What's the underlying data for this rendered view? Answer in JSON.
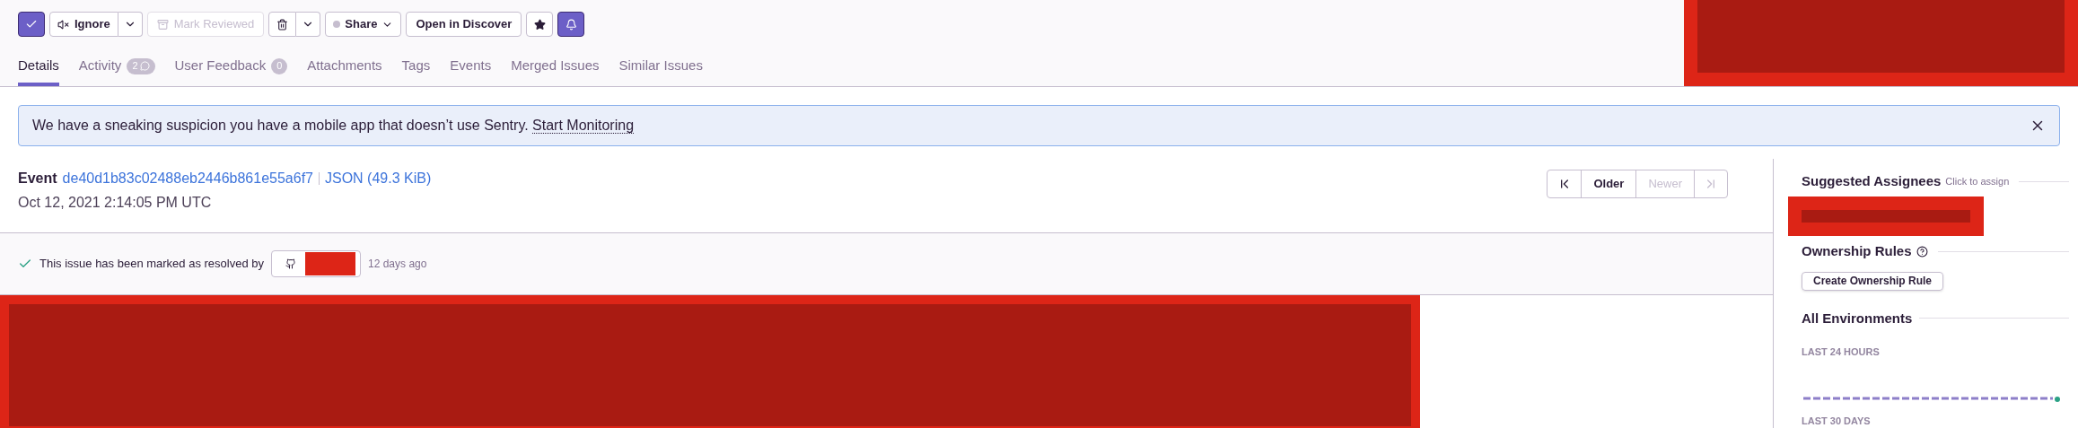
{
  "toolbar": [
    {
      "kind": "resolve",
      "selected": true
    },
    {
      "kind": "split",
      "label": "Ignore"
    },
    {
      "kind": "text",
      "label": "Mark Reviewed",
      "disabled": true
    },
    {
      "kind": "delete"
    },
    {
      "kind": "share",
      "label": "Share"
    },
    {
      "kind": "text",
      "label": "Open in Discover",
      "disabled": false
    },
    {
      "kind": "bookmark",
      "selected": false
    },
    {
      "kind": "subscribe",
      "selected": true
    }
  ],
  "tabs": [
    {
      "label": "Details",
      "selected": true
    },
    {
      "label": "Activity",
      "selected": false,
      "badge": "2",
      "kind": "comments"
    },
    {
      "label": "User Feedback",
      "selected": false,
      "badge": "0",
      "kind": "count"
    },
    {
      "label": "Attachments",
      "selected": false
    },
    {
      "label": "Tags",
      "selected": false
    },
    {
      "label": "Events",
      "selected": false
    },
    {
      "label": "Merged Issues",
      "selected": false
    },
    {
      "label": "Similar Issues",
      "selected": false
    }
  ],
  "banner": {
    "text": "We have a sneaking suspicion you have a mobile app that doesn’t use Sentry.",
    "link": "Start Monitoring"
  },
  "event": {
    "label": "Event",
    "id": "de40d1b83c02488eb2446b861e55a6f7",
    "json": "JSON (49.3 KiB)",
    "date": "Oct 12, 2021 2:14:05 PM UTC"
  },
  "pager": [
    {
      "kind": "first",
      "disabled": false
    },
    {
      "kind": "text",
      "label": "Older",
      "disabled": false
    },
    {
      "kind": "text",
      "label": "Newer",
      "disabled": true
    },
    {
      "kind": "last",
      "disabled": true
    }
  ],
  "resolution": {
    "text": "This issue has been marked as resolved by",
    "time": "12 days ago"
  },
  "sidebar": {
    "assignees_title": "Suggested Assignees",
    "assignees_hint": "Click to assign",
    "ownership_title": "Ownership Rules",
    "ownership_button": "Create Ownership Rule",
    "environments_title": "All Environments",
    "periods": [
      "LAST 24 HOURS",
      "LAST 30 DAYS"
    ]
  }
}
